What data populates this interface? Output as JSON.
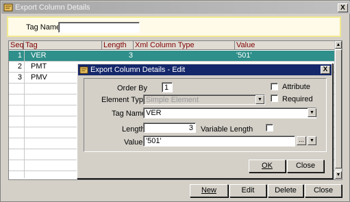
{
  "window": {
    "title": "Export Column Details",
    "close_glyph": "X"
  },
  "filter": {
    "tag_name_label": "Tag Name",
    "tag_name_value": ""
  },
  "grid": {
    "columns": [
      "Seq",
      "Tag",
      "Length",
      "Xml Column Type",
      "Value"
    ],
    "rows": [
      {
        "seq": "1",
        "tag": "VER",
        "length": "3",
        "xml_type": "",
        "value": "'501'"
      },
      {
        "seq": "2",
        "tag": "PMT",
        "length": "",
        "xml_type": "",
        "value": ""
      },
      {
        "seq": "3",
        "tag": "PMV",
        "length": "",
        "xml_type": "",
        "value": ""
      }
    ]
  },
  "buttons": {
    "new": "New",
    "edit": "Edit",
    "delete": "Delete",
    "close": "Close"
  },
  "dialog": {
    "title": "Export Column Details - Edit",
    "close_glyph": "X",
    "order_by_label": "Order By",
    "order_by_value": "1",
    "attribute_label": "Attribute",
    "element_type_label": "Element Type",
    "element_type_value": "Simple Element",
    "required_label": "Required",
    "tag_name_label": "Tag Name",
    "tag_name_value": "VER",
    "length_label": "Length",
    "length_value": "3",
    "variable_length_label": "Variable Length",
    "value_label": "Value",
    "value_value": "'501'",
    "ellipsis": "...",
    "ok": "OK",
    "close": "Close"
  },
  "colors": {
    "selected_row": "#2f8f8a",
    "header_text": "#800000",
    "dialog_title": "#15276b"
  }
}
